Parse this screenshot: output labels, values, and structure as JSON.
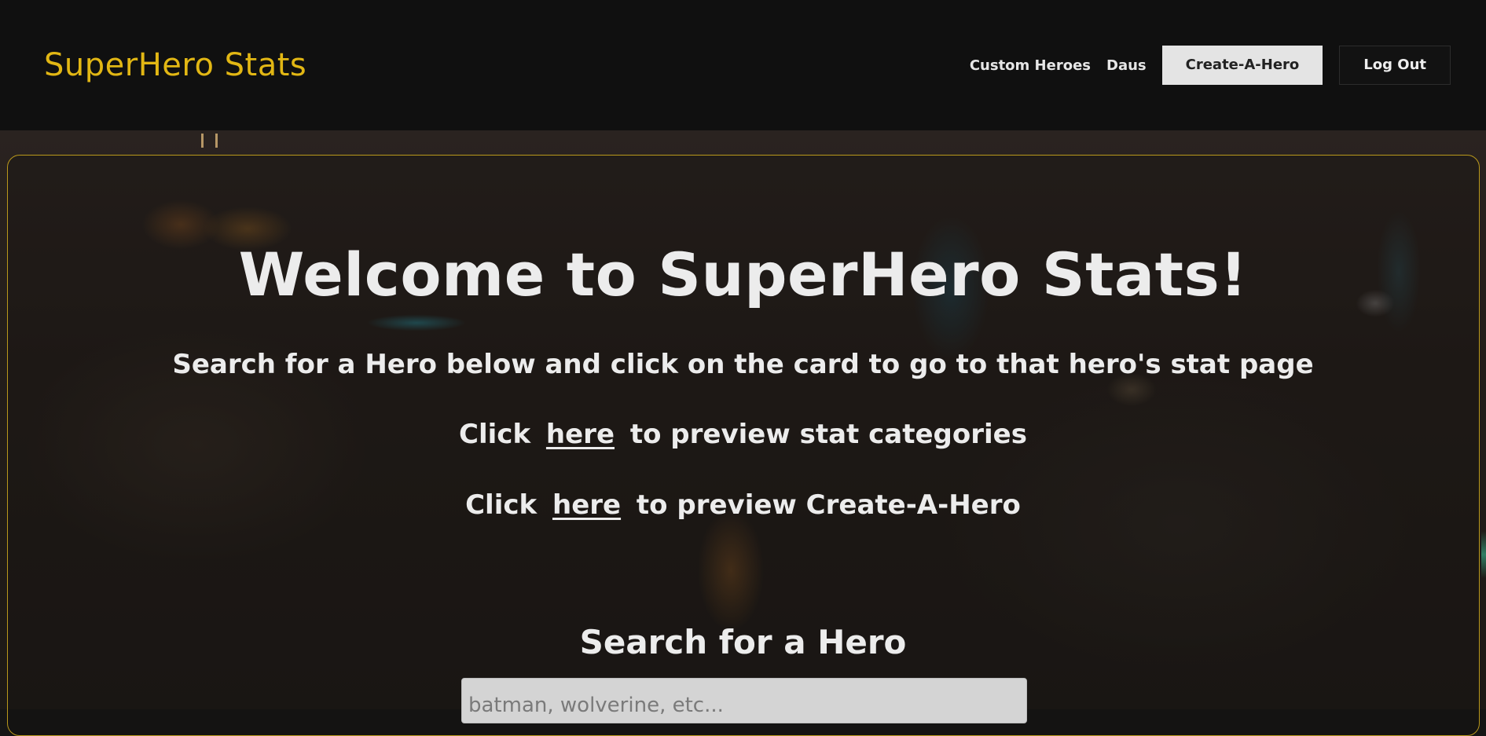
{
  "header": {
    "brand": "SuperHero Stats",
    "nav": {
      "custom_heroes": "Custom Heroes",
      "user": "Daus",
      "create_button": "Create-A-Hero",
      "logout_button": "Log Out"
    }
  },
  "main": {
    "title": "Welcome to SuperHero Stats!",
    "subtitle": "Search for a Hero below and click on the card to go to that hero's stat page",
    "preview_lines": [
      {
        "prefix": "Click",
        "link": "here",
        "suffix": "to preview stat categories"
      },
      {
        "prefix": "Click",
        "link": "here",
        "suffix": "to preview Create-A-Hero"
      }
    ],
    "search": {
      "label": "Search for a Hero",
      "placeholder": "batman, wolverine, etc...",
      "value": ""
    }
  },
  "colors": {
    "brand": "#e2b714",
    "panel_border": "#b9981c",
    "header_bg": "#101010"
  }
}
